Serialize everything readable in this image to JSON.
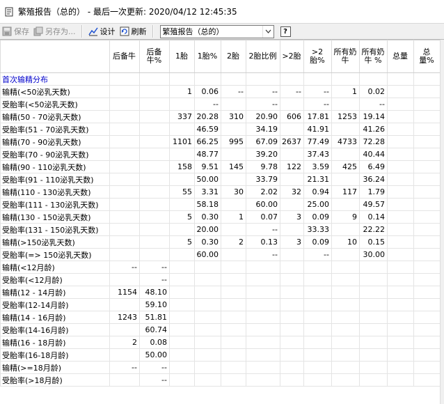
{
  "window": {
    "title": "繁殖报告（总的） - 最后一次更新: 2020/04/12 12:45:35"
  },
  "toolbar": {
    "save": "保存",
    "save_as": "另存为...",
    "design": "设计",
    "refresh": "刷新",
    "report_select": "繁殖报告（总的）",
    "help": "?"
  },
  "table": {
    "columns": [
      "",
      "后备牛",
      "后备牛%",
      "1胎",
      "1胎%",
      "2胎",
      "2胎比例",
      ">2胎",
      ">2胎%",
      "所有奶牛",
      "所有奶牛 %",
      "总量",
      "总量%"
    ],
    "rows": [
      {
        "label": "首次输精分布",
        "section": true,
        "v": [
          "",
          "",
          "",
          "",
          "",
          "",
          "",
          "",
          "",
          "",
          "",
          ""
        ]
      },
      {
        "label": "输精(<50泌乳天数)",
        "v": [
          "",
          "",
          "1",
          "0.06",
          "--",
          "--",
          "--",
          "--",
          "1",
          "0.02",
          "",
          ""
        ]
      },
      {
        "label": "受胎率(<50泌乳天数)",
        "v": [
          "",
          "",
          "",
          "--",
          "",
          "--",
          "",
          "--",
          "",
          "--",
          "",
          ""
        ]
      },
      {
        "label": "输精(50 - 70泌乳天数)",
        "v": [
          "",
          "",
          "337",
          "20.28",
          "310",
          "20.90",
          "606",
          "17.81",
          "1253",
          "19.14",
          "",
          ""
        ]
      },
      {
        "label": "受胎率(51 - 70泌乳天数)",
        "v": [
          "",
          "",
          "",
          "46.59",
          "",
          "34.19",
          "",
          "41.91",
          "",
          "41.26",
          "",
          ""
        ]
      },
      {
        "label": "输精(70 - 90泌乳天数)",
        "v": [
          "",
          "",
          "1101",
          "66.25",
          "995",
          "67.09",
          "2637",
          "77.49",
          "4733",
          "72.28",
          "",
          ""
        ]
      },
      {
        "label": "受胎率(70 - 90泌乳天数)",
        "v": [
          "",
          "",
          "",
          "48.77",
          "",
          "39.20",
          "",
          "37.43",
          "",
          "40.44",
          "",
          ""
        ]
      },
      {
        "label": "输精(90 - 110泌乳天数)",
        "v": [
          "",
          "",
          "158",
          "9.51",
          "145",
          "9.78",
          "122",
          "3.59",
          "425",
          "6.49",
          "",
          ""
        ]
      },
      {
        "label": "受胎率(91 - 110泌乳天数)",
        "v": [
          "",
          "",
          "",
          "50.00",
          "",
          "33.79",
          "",
          "21.31",
          "",
          "36.24",
          "",
          ""
        ]
      },
      {
        "label": "输精(110 - 130泌乳天数)",
        "v": [
          "",
          "",
          "55",
          "3.31",
          "30",
          "2.02",
          "32",
          "0.94",
          "117",
          "1.79",
          "",
          ""
        ]
      },
      {
        "label": "受胎率(111 - 130泌乳天数)",
        "v": [
          "",
          "",
          "",
          "58.18",
          "",
          "60.00",
          "",
          "25.00",
          "",
          "49.57",
          "",
          ""
        ]
      },
      {
        "label": "输精(130 - 150泌乳天数)",
        "v": [
          "",
          "",
          "5",
          "0.30",
          "1",
          "0.07",
          "3",
          "0.09",
          "9",
          "0.14",
          "",
          ""
        ]
      },
      {
        "label": "受胎率(131 - 150泌乳天数)",
        "v": [
          "",
          "",
          "",
          "20.00",
          "",
          "--",
          "",
          "33.33",
          "",
          "22.22",
          "",
          ""
        ]
      },
      {
        "label": "输精(>150泌乳天数)",
        "v": [
          "",
          "",
          "5",
          "0.30",
          "2",
          "0.13",
          "3",
          "0.09",
          "10",
          "0.15",
          "",
          ""
        ]
      },
      {
        "label": "受胎率(=> 150泌乳天数)",
        "v": [
          "",
          "",
          "",
          "60.00",
          "",
          "--",
          "",
          "--",
          "",
          "30.00",
          "",
          ""
        ]
      },
      {
        "label": "输精(<12月龄)",
        "v": [
          "--",
          "--",
          "",
          "",
          "",
          "",
          "",
          "",
          "",
          "",
          "",
          ""
        ]
      },
      {
        "label": " 受胎率(<12月龄)",
        "v": [
          "",
          "--",
          "",
          "",
          "",
          "",
          "",
          "",
          "",
          "",
          "",
          ""
        ]
      },
      {
        "label": "输精(12 - 14月龄)",
        "v": [
          "1154",
          "48.10",
          "",
          "",
          "",
          "",
          "",
          "",
          "",
          "",
          "",
          ""
        ]
      },
      {
        "label": "受胎率(12-14月龄)",
        "v": [
          "",
          "59.10",
          "",
          "",
          "",
          "",
          "",
          "",
          "",
          "",
          "",
          ""
        ]
      },
      {
        "label": "输精(14 - 16月龄)",
        "v": [
          "1243",
          "51.81",
          "",
          "",
          "",
          "",
          "",
          "",
          "",
          "",
          "",
          ""
        ]
      },
      {
        "label": "受胎率(14-16月龄)",
        "v": [
          "",
          "60.74",
          "",
          "",
          "",
          "",
          "",
          "",
          "",
          "",
          "",
          ""
        ]
      },
      {
        "label": "输精(16 - 18月龄)",
        "v": [
          "2",
          "0.08",
          "",
          "",
          "",
          "",
          "",
          "",
          "",
          "",
          "",
          ""
        ]
      },
      {
        "label": "受胎率(16-18月龄)",
        "v": [
          "",
          "50.00",
          "",
          "",
          "",
          "",
          "",
          "",
          "",
          "",
          "",
          ""
        ]
      },
      {
        "label": "输精(>=18月龄)",
        "v": [
          "--",
          "--",
          "",
          "",
          "",
          "",
          "",
          "",
          "",
          "",
          "",
          ""
        ]
      },
      {
        "label": "受胎率(>18月龄)",
        "v": [
          "",
          "--",
          "",
          "",
          "",
          "",
          "",
          "",
          "",
          "",
          "",
          ""
        ]
      }
    ]
  }
}
